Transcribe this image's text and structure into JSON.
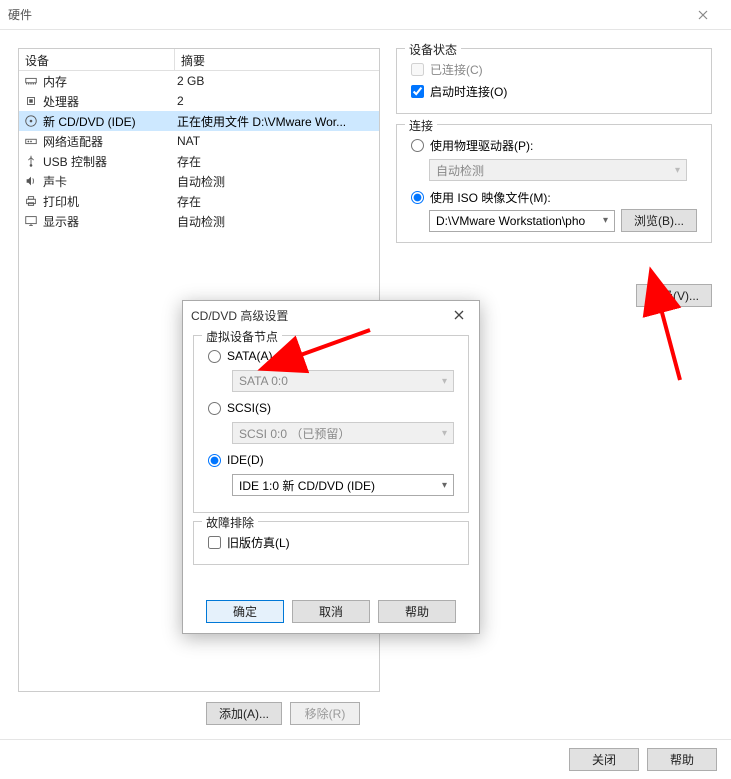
{
  "window": {
    "title": "硬件"
  },
  "device_table": {
    "headers": {
      "name": "设备",
      "summary": "摘要"
    },
    "rows": [
      {
        "icon": "memory-icon",
        "name": "内存",
        "summary": "2 GB"
      },
      {
        "icon": "cpu-icon",
        "name": "处理器",
        "summary": "2"
      },
      {
        "icon": "disc-icon",
        "name": "新 CD/DVD (IDE)",
        "summary": "正在使用文件 D:\\VMware Wor...",
        "selected": true
      },
      {
        "icon": "network-icon",
        "name": "网络适配器",
        "summary": "NAT"
      },
      {
        "icon": "usb-icon",
        "name": "USB 控制器",
        "summary": "存在"
      },
      {
        "icon": "sound-icon",
        "name": "声卡",
        "summary": "自动检测"
      },
      {
        "icon": "printer-icon",
        "name": "打印机",
        "summary": "存在"
      },
      {
        "icon": "display-icon",
        "name": "显示器",
        "summary": "自动检测"
      }
    ]
  },
  "device_buttons": {
    "add": "添加(A)...",
    "remove": "移除(R)"
  },
  "status_group": {
    "legend": "设备状态",
    "connected": "已连接(C)",
    "connect_on_start": "启动时连接(O)"
  },
  "connection_group": {
    "legend": "连接",
    "physical": "使用物理驱动器(P):",
    "physical_value": "自动检测",
    "iso": "使用 ISO 映像文件(M):",
    "iso_value": "D:\\VMware Workstation\\pho",
    "browse": "浏览(B)..."
  },
  "advanced_btn": "高级(V)...",
  "footer": {
    "close": "关闭",
    "help": "帮助"
  },
  "modal": {
    "title": "CD/DVD 高级设置",
    "node_legend": "虚拟设备节点",
    "sata_label": "SATA(A)",
    "sata_value": "SATA 0:0",
    "scsi_label": "SCSI(S)",
    "scsi_value": "SCSI 0:0 （已预留）",
    "ide_label": "IDE(D)",
    "ide_value": "IDE 1:0  新 CD/DVD (IDE)",
    "trouble_legend": "故障排除",
    "legacy": "旧版仿真(L)",
    "ok": "确定",
    "cancel": "取消",
    "help": "帮助"
  }
}
